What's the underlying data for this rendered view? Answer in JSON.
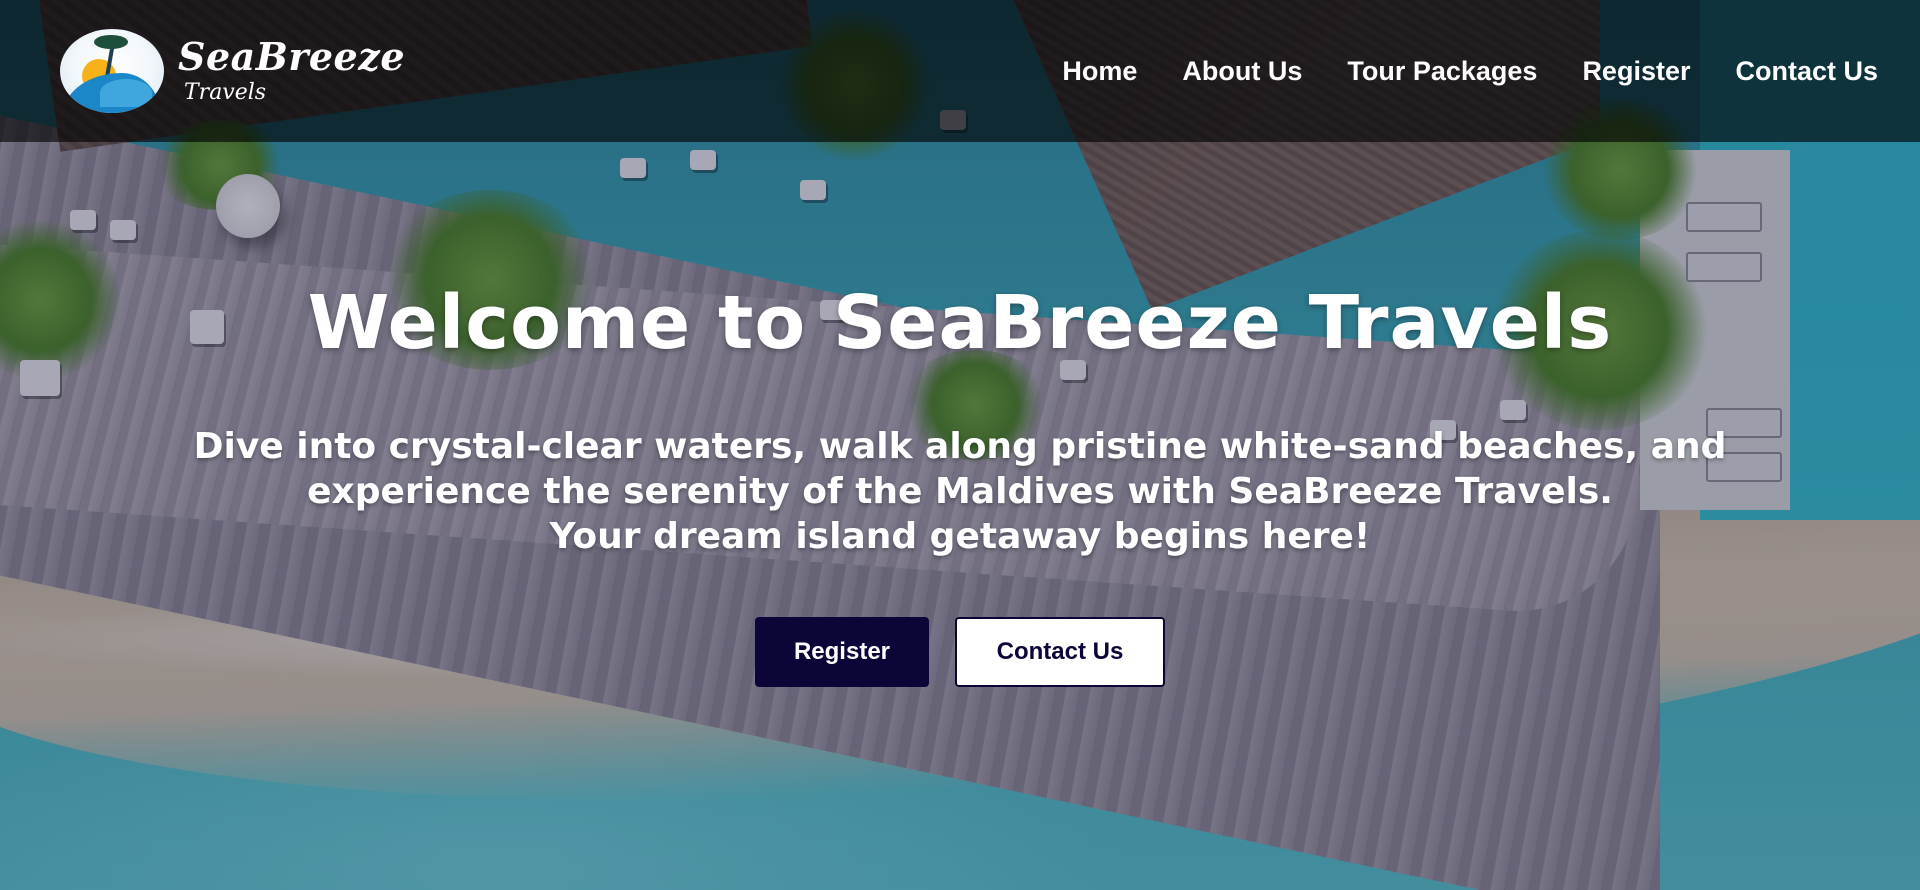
{
  "brand": {
    "name": "SeaBreeze",
    "tagline": "Travels",
    "logo_icon": "sun-palm-wave-logo"
  },
  "nav": {
    "items": [
      {
        "label": "Home"
      },
      {
        "label": "About Us"
      },
      {
        "label": "Tour Packages"
      },
      {
        "label": "Register"
      },
      {
        "label": "Contact Us"
      }
    ]
  },
  "hero": {
    "title": "Welcome to SeaBreeze Travels",
    "line1": "Dive into crystal-clear waters, walk along pristine white-sand beaches, and",
    "line2": "experience the serenity of the Maldives with SeaBreeze Travels.",
    "line3": "Your dream island getaway begins here!",
    "primary_button": "Register",
    "secondary_button": "Contact Us"
  },
  "colors": {
    "header_bg": "#000000",
    "button_primary": "#0b0538",
    "text": "#ffffff"
  }
}
